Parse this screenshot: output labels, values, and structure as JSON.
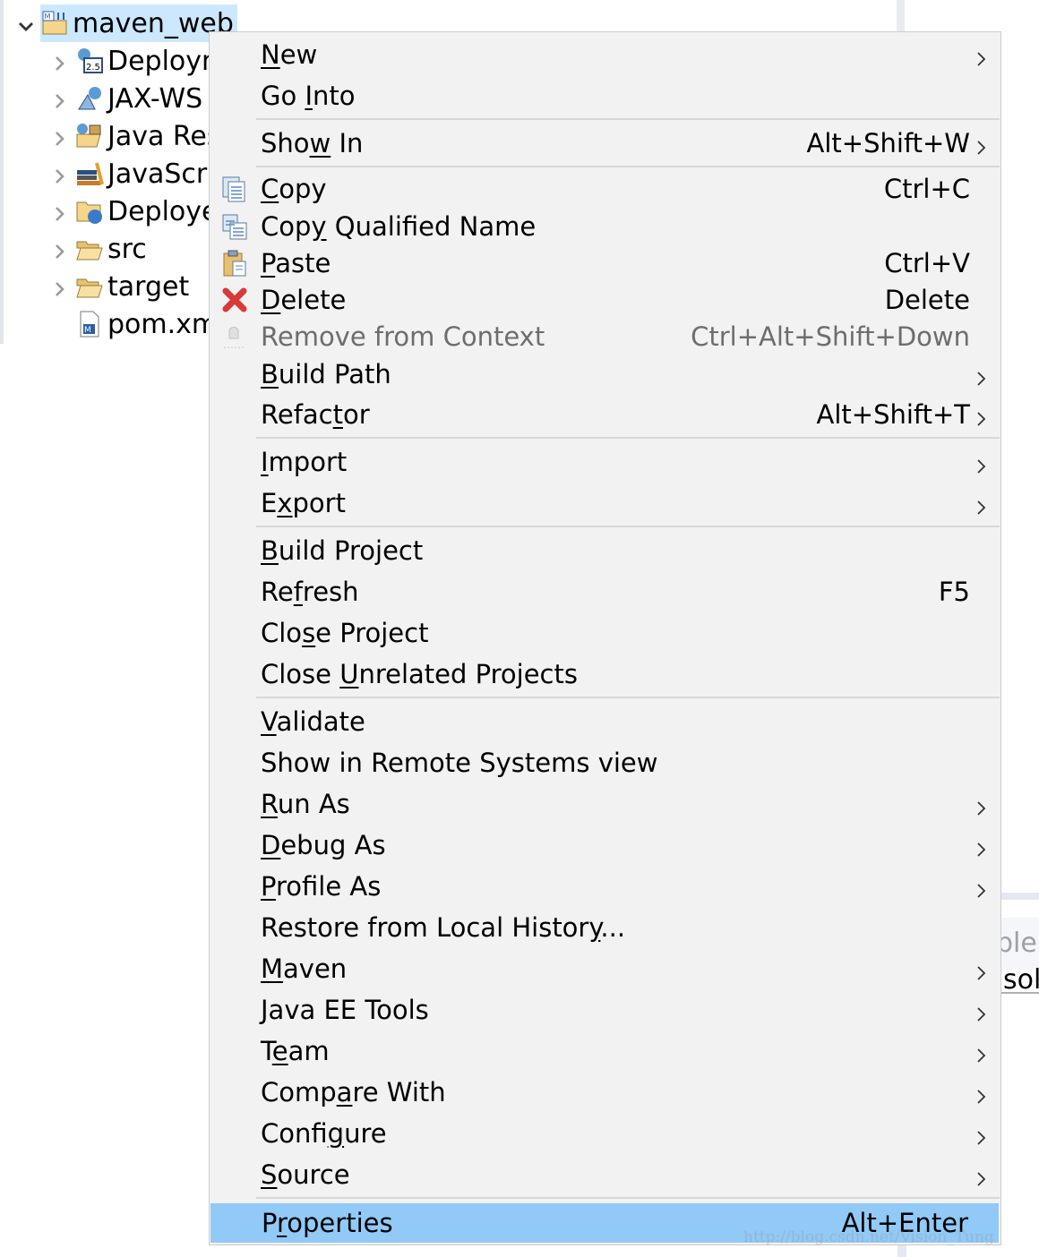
{
  "project_explorer": {
    "root": {
      "label": "maven_web",
      "icon": "maven-web-project-icon",
      "expanded": true,
      "selected": true
    },
    "children": [
      {
        "label": "Deploym",
        "icon": "deployment-descriptor-icon",
        "expandable": true
      },
      {
        "label": "JAX-WS",
        "icon": "jax-ws-icon",
        "expandable": true
      },
      {
        "label": "Java Res",
        "icon": "java-resources-icon",
        "expandable": true
      },
      {
        "label": "JavaScri",
        "icon": "javascript-resources-icon",
        "expandable": true
      },
      {
        "label": "Deploye",
        "icon": "deployed-resources-icon",
        "expandable": true
      },
      {
        "label": "src",
        "icon": "folder-icon",
        "expandable": true
      },
      {
        "label": "target",
        "icon": "folder-icon",
        "expandable": true
      },
      {
        "label": "pom.xm",
        "icon": "maven-pom-file-icon",
        "expandable": false
      }
    ]
  },
  "context_menu": {
    "items": [
      {
        "pre": "",
        "key": "N",
        "post": "ew",
        "submenu": true
      },
      {
        "pre": "Go ",
        "key": "I",
        "post": "nto"
      },
      {
        "separator": true
      },
      {
        "pre": "Sho",
        "key": "w",
        "post": " In",
        "shortcut": "Alt+Shift+W",
        "submenu": true
      },
      {
        "separator": true
      },
      {
        "pre": "",
        "key": "C",
        "post": "opy",
        "shortcut": "Ctrl+C",
        "icon": "copy-icon"
      },
      {
        "pre": "Cop",
        "key": "y",
        "post": " Qualified Name",
        "icon": "copy-qualified-name-icon"
      },
      {
        "pre": "",
        "key": "P",
        "post": "aste",
        "shortcut": "Ctrl+V",
        "icon": "paste-icon"
      },
      {
        "pre": "",
        "key": "D",
        "post": "elete",
        "shortcut": "Delete",
        "icon": "delete-icon"
      },
      {
        "pre": "Remove from Context",
        "key": "",
        "post": "",
        "shortcut": "Ctrl+Alt+Shift+Down",
        "icon": "remove-from-context-icon",
        "disabled": true
      },
      {
        "pre": "",
        "key": "B",
        "post": "uild Path",
        "submenu": true
      },
      {
        "pre": "Refac",
        "key": "t",
        "post": "or",
        "shortcut": "Alt+Shift+T",
        "submenu": true
      },
      {
        "separator": true
      },
      {
        "pre": "",
        "key": "I",
        "post": "mport",
        "submenu": true
      },
      {
        "pre": "E",
        "key": "x",
        "post": "port",
        "submenu": true
      },
      {
        "separator": true
      },
      {
        "pre": "",
        "key": "B",
        "post": "uild Project"
      },
      {
        "pre": "Re",
        "key": "f",
        "post": "resh",
        "shortcut": "F5"
      },
      {
        "pre": "Clo",
        "key": "s",
        "post": "e Project"
      },
      {
        "pre": "Close ",
        "key": "U",
        "post": "nrelated Projects"
      },
      {
        "separator": true
      },
      {
        "pre": "",
        "key": "V",
        "post": "alidate"
      },
      {
        "pre": "Show in Remote Systems view",
        "key": "",
        "post": ""
      },
      {
        "pre": "",
        "key": "R",
        "post": "un As",
        "submenu": true
      },
      {
        "pre": "",
        "key": "D",
        "post": "ebug As",
        "submenu": true
      },
      {
        "pre": "",
        "key": "P",
        "post": "rofile As",
        "submenu": true
      },
      {
        "pre": "Restore from Local Histor",
        "key": "y",
        "post": "..."
      },
      {
        "pre": "",
        "key": "M",
        "post": "aven",
        "submenu": true
      },
      {
        "pre": "Java EE Tools",
        "key": "",
        "post": "",
        "submenu": true
      },
      {
        "pre": "T",
        "key": "e",
        "post": "am",
        "submenu": true
      },
      {
        "pre": "Comp",
        "key": "a",
        "post": "re With",
        "submenu": true
      },
      {
        "pre": "Confi",
        "key": "g",
        "post": "ure",
        "submenu": true
      },
      {
        "pre": "",
        "key": "S",
        "post": "ource",
        "submenu": true
      },
      {
        "separator": true
      },
      {
        "pre": "P",
        "key": "r",
        "post": "operties",
        "shortcut": "Alt+Enter",
        "highlighted": true
      }
    ]
  },
  "right_panel": {
    "partial_tab": "bler",
    "partial_text": "sol"
  },
  "watermark": "http://blog.csdn.net/Vision_Tung",
  "colors": {
    "selection": "#cce8ff",
    "menu_bg": "#f2f2f2",
    "menu_highlight": "#91c9f7",
    "disabled_text": "#6d6d6d"
  }
}
